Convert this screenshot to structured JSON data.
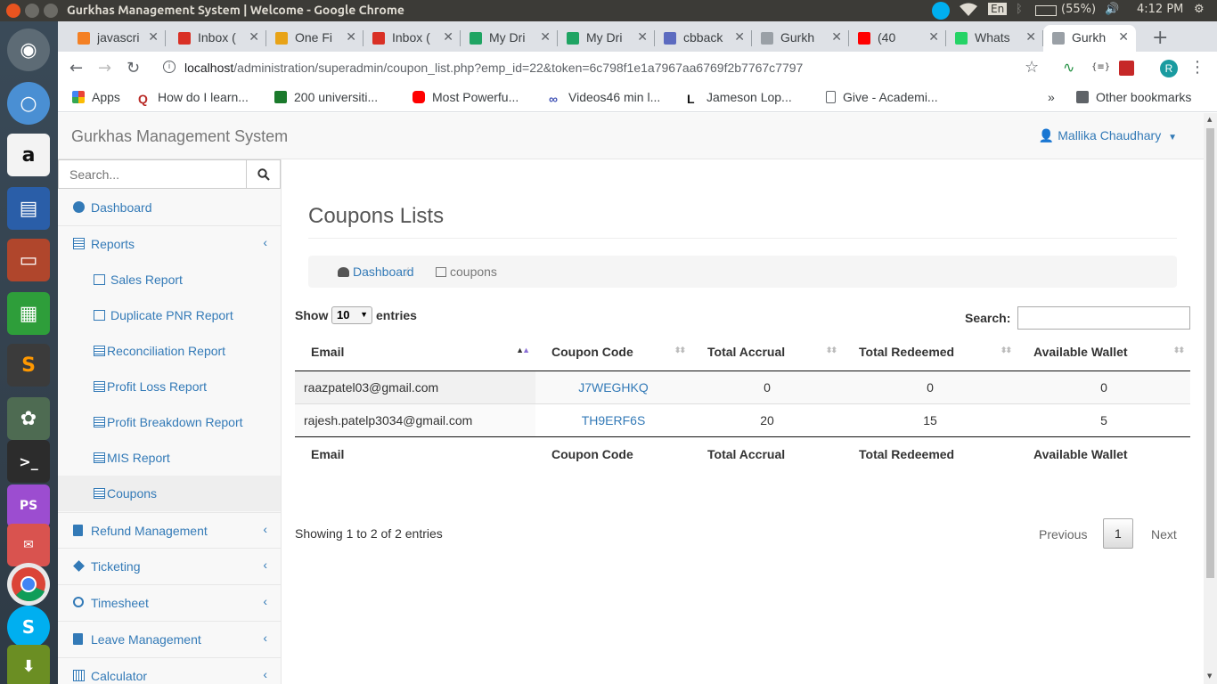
{
  "os": {
    "window_title": "Gurkhas Management System | Welcome - Google Chrome",
    "battery": "(55%)",
    "time": "4:12 PM",
    "keyboard": "En"
  },
  "browser": {
    "tabs": [
      {
        "label": "javascri",
        "icon": "stackoverflow-icon",
        "color": "#f48024"
      },
      {
        "label": "Inbox (",
        "icon": "gmail-icon",
        "color": "#d93025"
      },
      {
        "label": "One Fi",
        "icon": "page-icon",
        "color": "#e8a317"
      },
      {
        "label": "Inbox (",
        "icon": "gmail-icon",
        "color": "#d93025"
      },
      {
        "label": "My Dri",
        "icon": "drive-icon",
        "color": "#1fa463"
      },
      {
        "label": "My Dri",
        "icon": "drive-icon",
        "color": "#1fa463"
      },
      {
        "label": "cbback",
        "icon": "docs-icon",
        "color": "#5c6bc0"
      },
      {
        "label": "Gurkh",
        "icon": "page-icon",
        "color": "#9aa0a6"
      },
      {
        "label": "(40",
        "icon": "youtube-icon",
        "color": "#ff0000"
      },
      {
        "label": "Whats",
        "icon": "whatsapp-icon",
        "color": "#25d366"
      },
      {
        "label": "Gurkh",
        "icon": "page-icon",
        "color": "#9aa0a6"
      }
    ],
    "url_host": "localhost",
    "url_path": "/administration/superadmin/coupon_list.php?emp_id=22&token=6c798f1e1a7967aa6769f2b7767c7797",
    "profile_initial": "R",
    "bookmarks": [
      "Apps",
      "How do I learn...",
      "200 universiti...",
      "Most Powerfu...",
      "Videos46 min l...",
      "Jameson Lop...",
      "Give - Academi..."
    ],
    "other_bookmarks": "Other bookmarks",
    "more": "»"
  },
  "app": {
    "brand": "Gurkhas Management System",
    "user": "Mallika Chaudhary",
    "search_placeholder": "Search...",
    "sidebar": {
      "dashboard": "Dashboard",
      "reports": "Reports",
      "report_items": [
        "Sales Report",
        "Duplicate PNR Report",
        "Reconciliation Report",
        "Profit Loss Report",
        "Profit Breakdown Report",
        "MIS Report",
        "Coupons"
      ],
      "refund": "Refund Management",
      "ticketing": "Ticketing",
      "timesheet": "Timesheet",
      "leave": "Leave Management",
      "calculator": "Calculator"
    },
    "page_title": "Coupons Lists",
    "breadcrumb": {
      "home": "Dashboard",
      "current": "coupons",
      "separator": "/"
    },
    "table_controls": {
      "show": "Show",
      "length": "10",
      "entries": "entries",
      "search_label": "Search:"
    },
    "table": {
      "columns": [
        "Email",
        "Coupon Code",
        "Total Accrual",
        "Total Redeemed",
        "Available Wallet"
      ],
      "rows": [
        {
          "email": "raazpatel03@gmail.com",
          "code": "J7WEGHKQ",
          "accrual": "0",
          "redeemed": "0",
          "wallet": "0"
        },
        {
          "email": "rajesh.patelp3034@gmail.com",
          "code": "TH9ERF6S",
          "accrual": "20",
          "redeemed": "15",
          "wallet": "5"
        }
      ]
    },
    "info": "Showing 1 to 2 of 2 entries",
    "pagination": {
      "previous": "Previous",
      "page": "1",
      "next": "Next"
    }
  }
}
